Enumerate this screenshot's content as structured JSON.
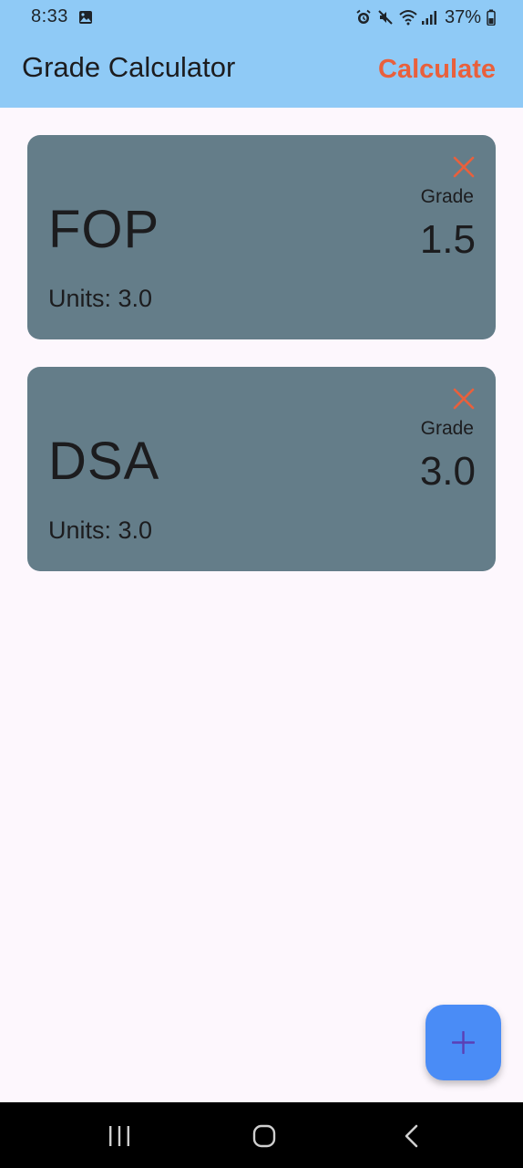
{
  "status_bar": {
    "time": "8:33",
    "battery": "37%"
  },
  "app_bar": {
    "title": "Grade Calculator",
    "action_label": "Calculate"
  },
  "courses": [
    {
      "name": "FOP",
      "units_text": "Units: 3.0",
      "grade_label": "Grade",
      "grade": "1.5"
    },
    {
      "name": "DSA",
      "units_text": "Units: 3.0",
      "grade_label": "Grade",
      "grade": "3.0"
    }
  ],
  "colors": {
    "header_bg": "#8fcaf6",
    "accent": "#e9603c",
    "card_bg": "#647d89",
    "fab_bg": "#4a8cf6",
    "fab_icon": "#5b3fb5"
  },
  "icons": {
    "status_left": "image-icon",
    "status_right": [
      "alarm-icon",
      "mute-icon",
      "wifi-icon",
      "signal-icon",
      "battery-icon"
    ],
    "remove": "close-icon",
    "fab": "plus-icon",
    "nav": [
      "recent-apps-icon",
      "home-icon",
      "back-icon"
    ]
  }
}
